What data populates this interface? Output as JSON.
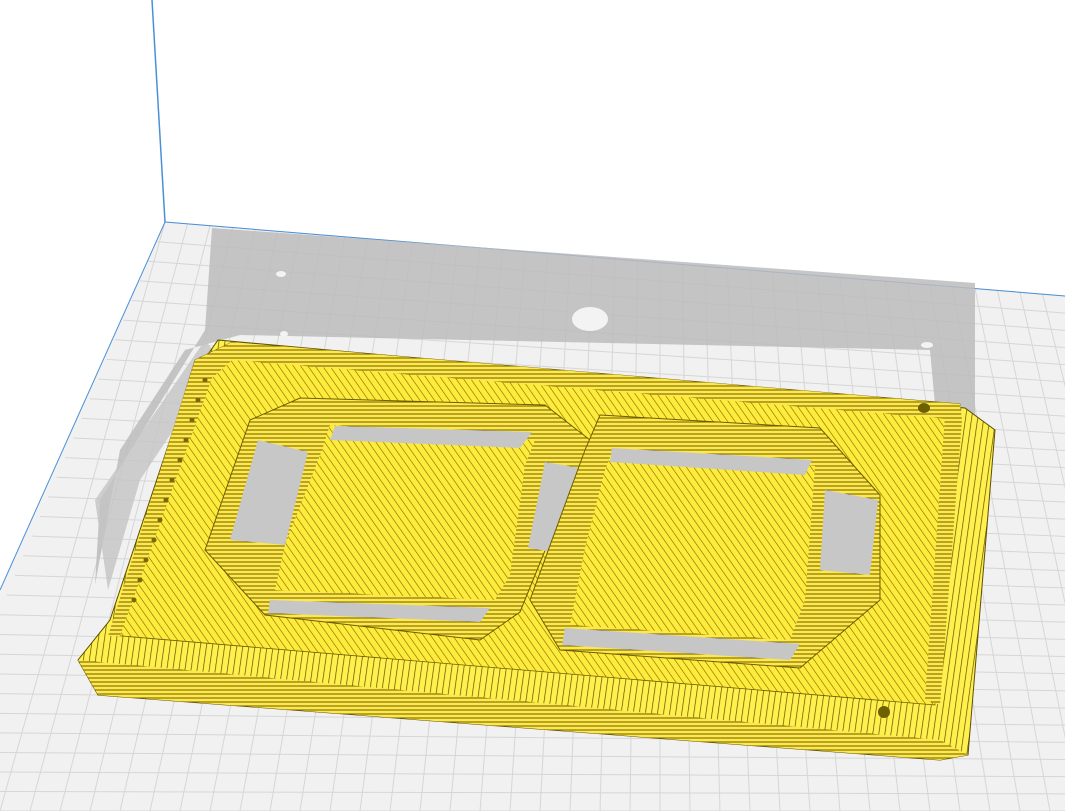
{
  "viewport": {
    "kind": "3d-slicer-layer-preview",
    "colors": {
      "background": "#ffffff",
      "build_plate": "#f2f2f2",
      "grid_line": "#d6d6d6",
      "build_volume_edge": "#4a90d9",
      "shadow": "#bdbdbd",
      "model_fill": "#ffeb3b",
      "model_line": "#6e5f00",
      "hole": "#c7c7c7"
    }
  }
}
